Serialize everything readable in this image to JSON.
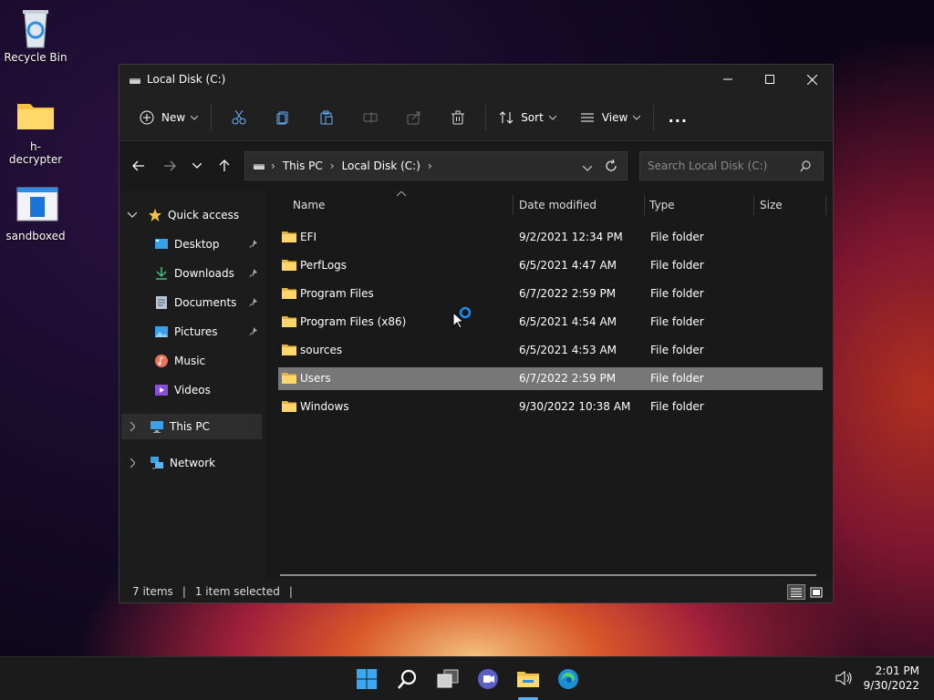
{
  "desktop": {
    "icons": [
      {
        "label": "Recycle Bin"
      },
      {
        "label": "h-decrypter"
      },
      {
        "label": "sandboxed"
      }
    ]
  },
  "window": {
    "title": "Local Disk (C:)",
    "toolbar": {
      "new_label": "New",
      "sort_label": "Sort",
      "view_label": "View",
      "more_label": "..."
    },
    "address": {
      "segments": [
        "This PC",
        "Local Disk (C:)"
      ],
      "search_placeholder": "Search Local Disk (C:)"
    },
    "nav": {
      "quick_access": "Quick access",
      "items": [
        {
          "label": "Desktop",
          "pinned": true
        },
        {
          "label": "Downloads",
          "pinned": true
        },
        {
          "label": "Documents",
          "pinned": true
        },
        {
          "label": "Pictures",
          "pinned": true
        },
        {
          "label": "Music",
          "pinned": false
        },
        {
          "label": "Videos",
          "pinned": false
        }
      ],
      "this_pc": "This PC",
      "network": "Network"
    },
    "columns": {
      "name": "Name",
      "date": "Date modified",
      "type": "Type",
      "size": "Size"
    },
    "files": [
      {
        "name": "EFI",
        "date": "9/2/2021 12:34 PM",
        "type": "File folder",
        "size": "",
        "selected": false
      },
      {
        "name": "PerfLogs",
        "date": "6/5/2021 4:47 AM",
        "type": "File folder",
        "size": "",
        "selected": false
      },
      {
        "name": "Program Files",
        "date": "6/7/2022 2:59 PM",
        "type": "File folder",
        "size": "",
        "selected": false
      },
      {
        "name": "Program Files (x86)",
        "date": "6/5/2021 4:54 AM",
        "type": "File folder",
        "size": "",
        "selected": false
      },
      {
        "name": "sources",
        "date": "6/5/2021 4:53 AM",
        "type": "File folder",
        "size": "",
        "selected": false
      },
      {
        "name": "Users",
        "date": "6/7/2022 2:59 PM",
        "type": "File folder",
        "size": "",
        "selected": true
      },
      {
        "name": "Windows",
        "date": "9/30/2022 10:38 AM",
        "type": "File folder",
        "size": "",
        "selected": false
      }
    ],
    "status": {
      "count": "7 items",
      "selection": "1 item selected"
    }
  },
  "taskbar": {
    "time": "2:01 PM",
    "date": "9/30/2022"
  },
  "colors": {
    "accent": "#0078d4",
    "selected_row": "#777777",
    "folder": "#f6c244"
  }
}
